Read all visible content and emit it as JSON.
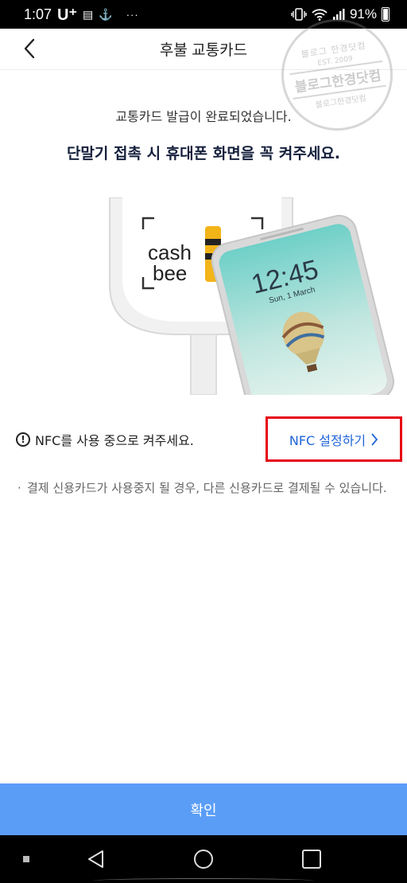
{
  "status_bar": {
    "time": "1:07",
    "carrier": "U⁺",
    "battery_percent": "91%"
  },
  "header": {
    "title": "후불 교통카드"
  },
  "watermark": {
    "top": "블로그 한경닷컴",
    "est": "EST. 2009",
    "main": "블로그한경닷컴",
    "bottom": "블로그한경닷컴"
  },
  "content": {
    "message_complete": "교통카드 발급이 완료되었습니다.",
    "message_instruction": "단말기 접촉 시 휴대폰 화면을 꼭 켜주세요.",
    "nfc_notice": "NFC를 사용 중으로 켜주세요.",
    "nfc_settings_link": "NFC 설정하기",
    "note": "결제 신용카드가 사용중지 될 경우, 다른 신용카드로 결제될 수 있습니다."
  },
  "illustration": {
    "terminal_brand_line1": "cash",
    "terminal_brand_line2": "bee",
    "phone_clock": "12:45",
    "phone_date": "Sun, 1 March"
  },
  "footer": {
    "confirm_label": "확인"
  },
  "colors": {
    "accent_blue": "#5a9df7",
    "link_blue": "#1f64d8",
    "highlight_red": "#e60012"
  },
  "icons": [
    "back-arrow-icon",
    "alert-circle-icon",
    "chevron-right-icon",
    "vibrate-icon",
    "wifi-icon",
    "signal-icon",
    "battery-icon"
  ]
}
